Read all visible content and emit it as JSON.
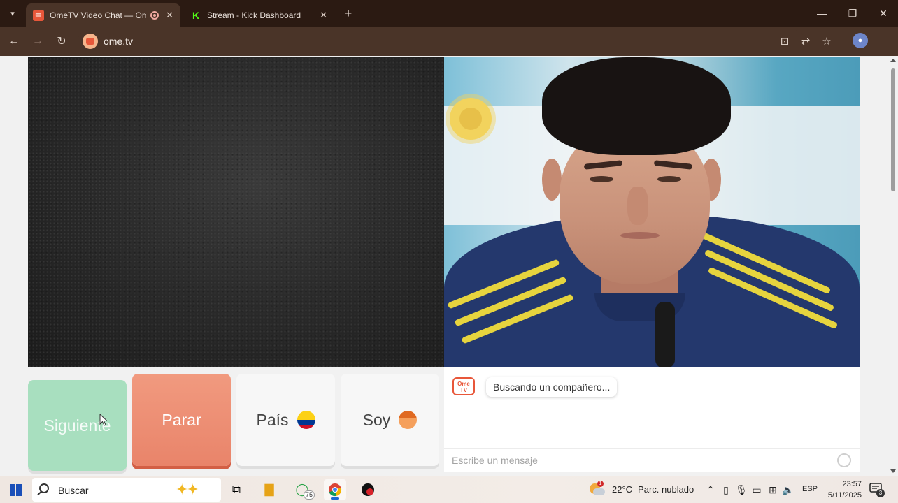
{
  "browser": {
    "tabs": [
      {
        "title": "OmeTV Video Chat — Ome",
        "active": true,
        "recording": true
      },
      {
        "title": "Stream - Kick Dashboard",
        "active": false
      }
    ],
    "new_tab_icon": "plus-icon",
    "address": "ome.tv",
    "window_controls": [
      "minimize-icon",
      "restore-icon",
      "close-icon"
    ]
  },
  "page": {
    "buttons": {
      "next": "Siguiente",
      "stop": "Parar",
      "country": "País",
      "gender": "Soy"
    },
    "country_flag": {
      "name": "Colombia",
      "colors": [
        "#fcd116",
        "#003893",
        "#ce1126"
      ]
    },
    "chat": {
      "logo_text": "Ome TV",
      "status_message": "Buscando un compañero...",
      "input_placeholder": "Escribe un mensaje"
    }
  },
  "taskbar": {
    "search_placeholder": "Buscar",
    "whatsapp_badge": "75",
    "weather": {
      "temperature": "22°C",
      "condition": "Parc. nublado",
      "alert_count": "1"
    },
    "language": "ESP",
    "time": "23:57",
    "date": "5/11/2025",
    "notifications": "3"
  },
  "colors": {
    "brand_accent": "#e8573a",
    "next_button": "#a8dfbf",
    "stop_button": "#ee8f74",
    "browser_frame": "#2b1a12"
  }
}
